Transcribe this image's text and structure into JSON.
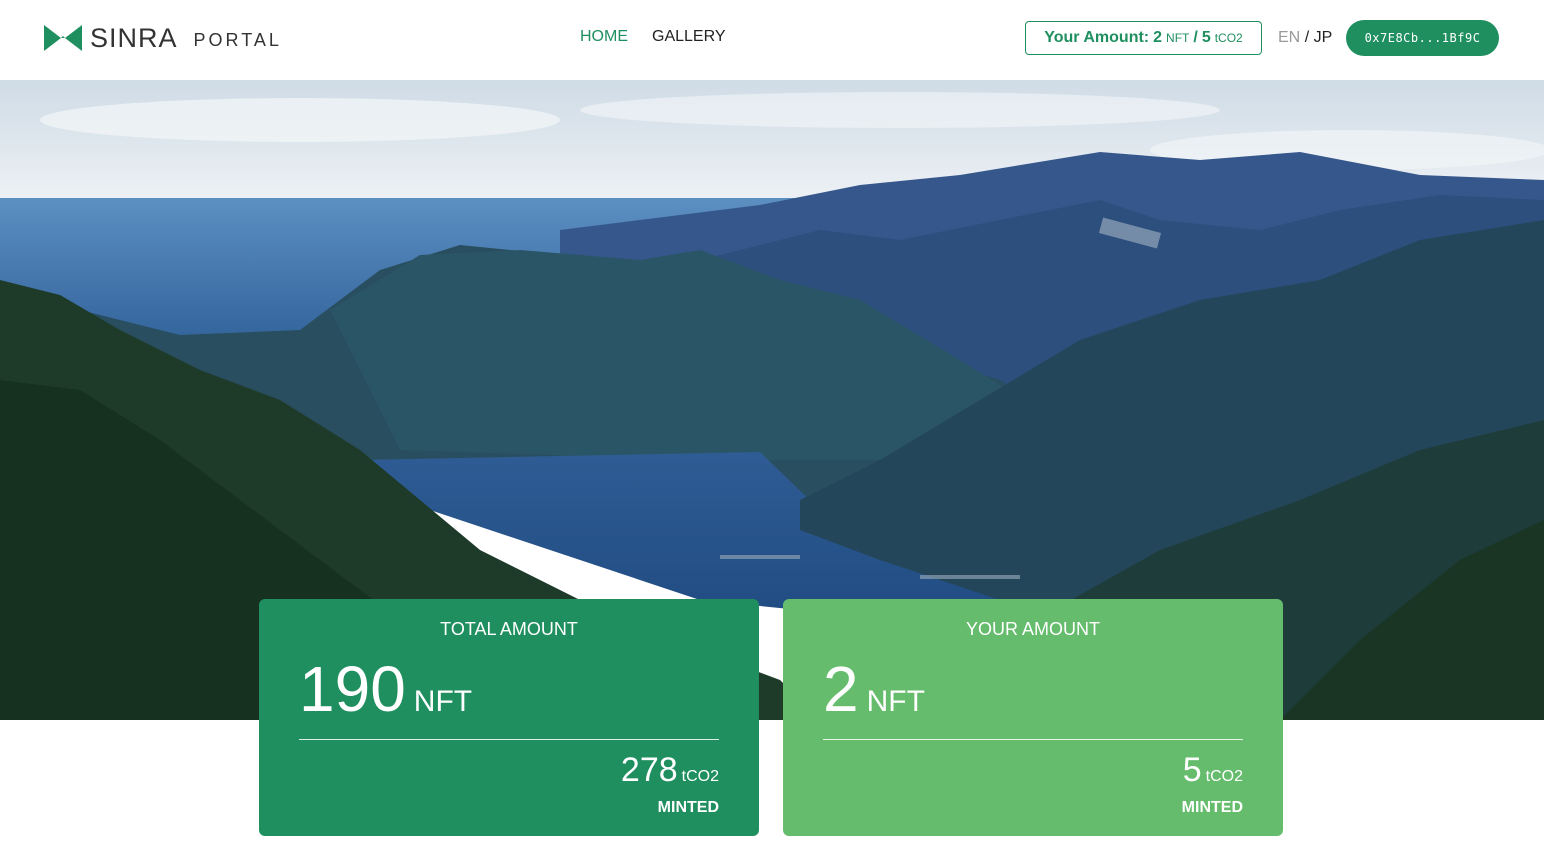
{
  "header": {
    "brand": "SINRA",
    "brand_sub": "PORTAL",
    "nav": [
      {
        "label": "HOME",
        "active": true
      },
      {
        "label": "GALLERY",
        "active": false
      }
    ],
    "amount_badge": {
      "prefix": "Your Amount:",
      "nft_value": "2",
      "nft_unit": "NFT",
      "separator": "/",
      "co2_value": "5",
      "co2_unit": "tCO2"
    },
    "lang": {
      "en": "EN",
      "separator": "/",
      "jp": "JP",
      "active": "JP"
    },
    "wallet_address": "0x7E8Cb...1Bf9C"
  },
  "hero": {
    "icon": "mountain-bay-landscape"
  },
  "cards": {
    "total": {
      "title": "TOTAL AMOUNT",
      "main_value": "190",
      "main_unit": "NFT",
      "sub_value": "278",
      "sub_unit": "tCO2",
      "status": "MINTED"
    },
    "yours": {
      "title": "YOUR AMOUNT",
      "main_value": "2",
      "main_unit": "NFT",
      "sub_value": "5",
      "sub_unit": "tCO2",
      "status": "MINTED"
    }
  },
  "colors": {
    "primary": "#1f8f5f",
    "secondary": "#64bc6c",
    "muted": "#999999"
  }
}
